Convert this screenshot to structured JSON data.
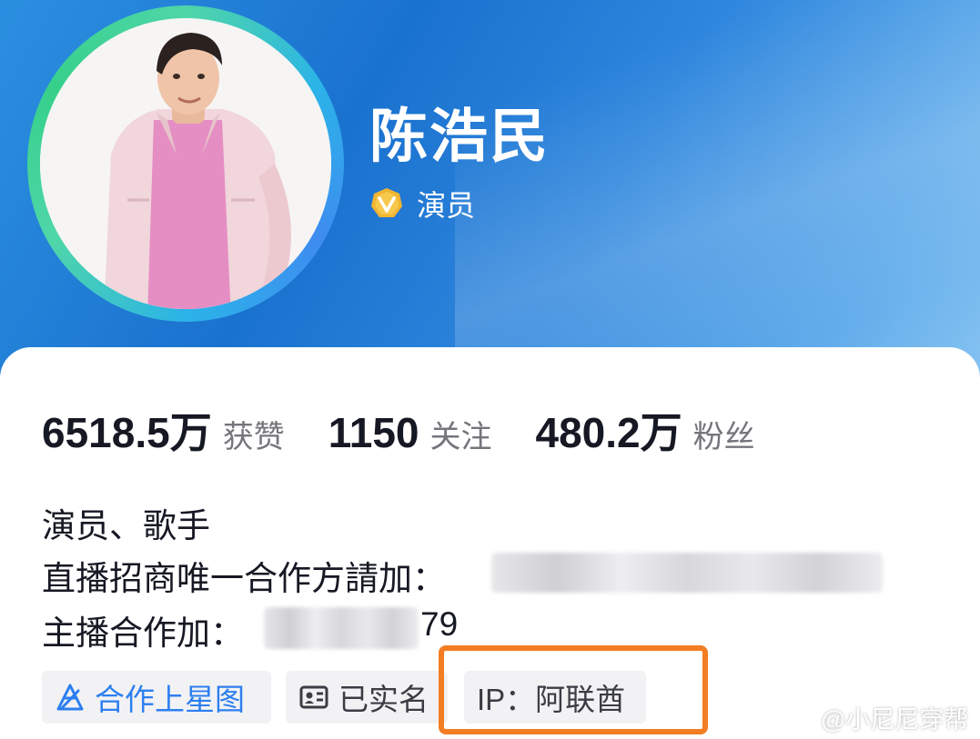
{
  "profile": {
    "name": "陈浩民",
    "verification": "演员"
  },
  "stats": [
    {
      "value": "6518.5万",
      "label": "获赞"
    },
    {
      "value": "1150",
      "label": "关注"
    },
    {
      "value": "480.2万",
      "label": "粉丝"
    }
  ],
  "bio": {
    "line1": "演员、歌手",
    "line2_prefix": "直播招商唯一合作方請加：",
    "line3_prefix": "主播合作加：",
    "line3_suffix": "79"
  },
  "tags": {
    "star_map": "合作上星图",
    "real_name": "已实名",
    "ip": "IP：阿联酋"
  },
  "watermark": "@小尼尼穿帮",
  "colors": {
    "header_blue": "#1a72cf",
    "highlight_orange": "#f37d22",
    "link_blue": "#2d7ff0",
    "verify_gold": "#f2b531"
  }
}
